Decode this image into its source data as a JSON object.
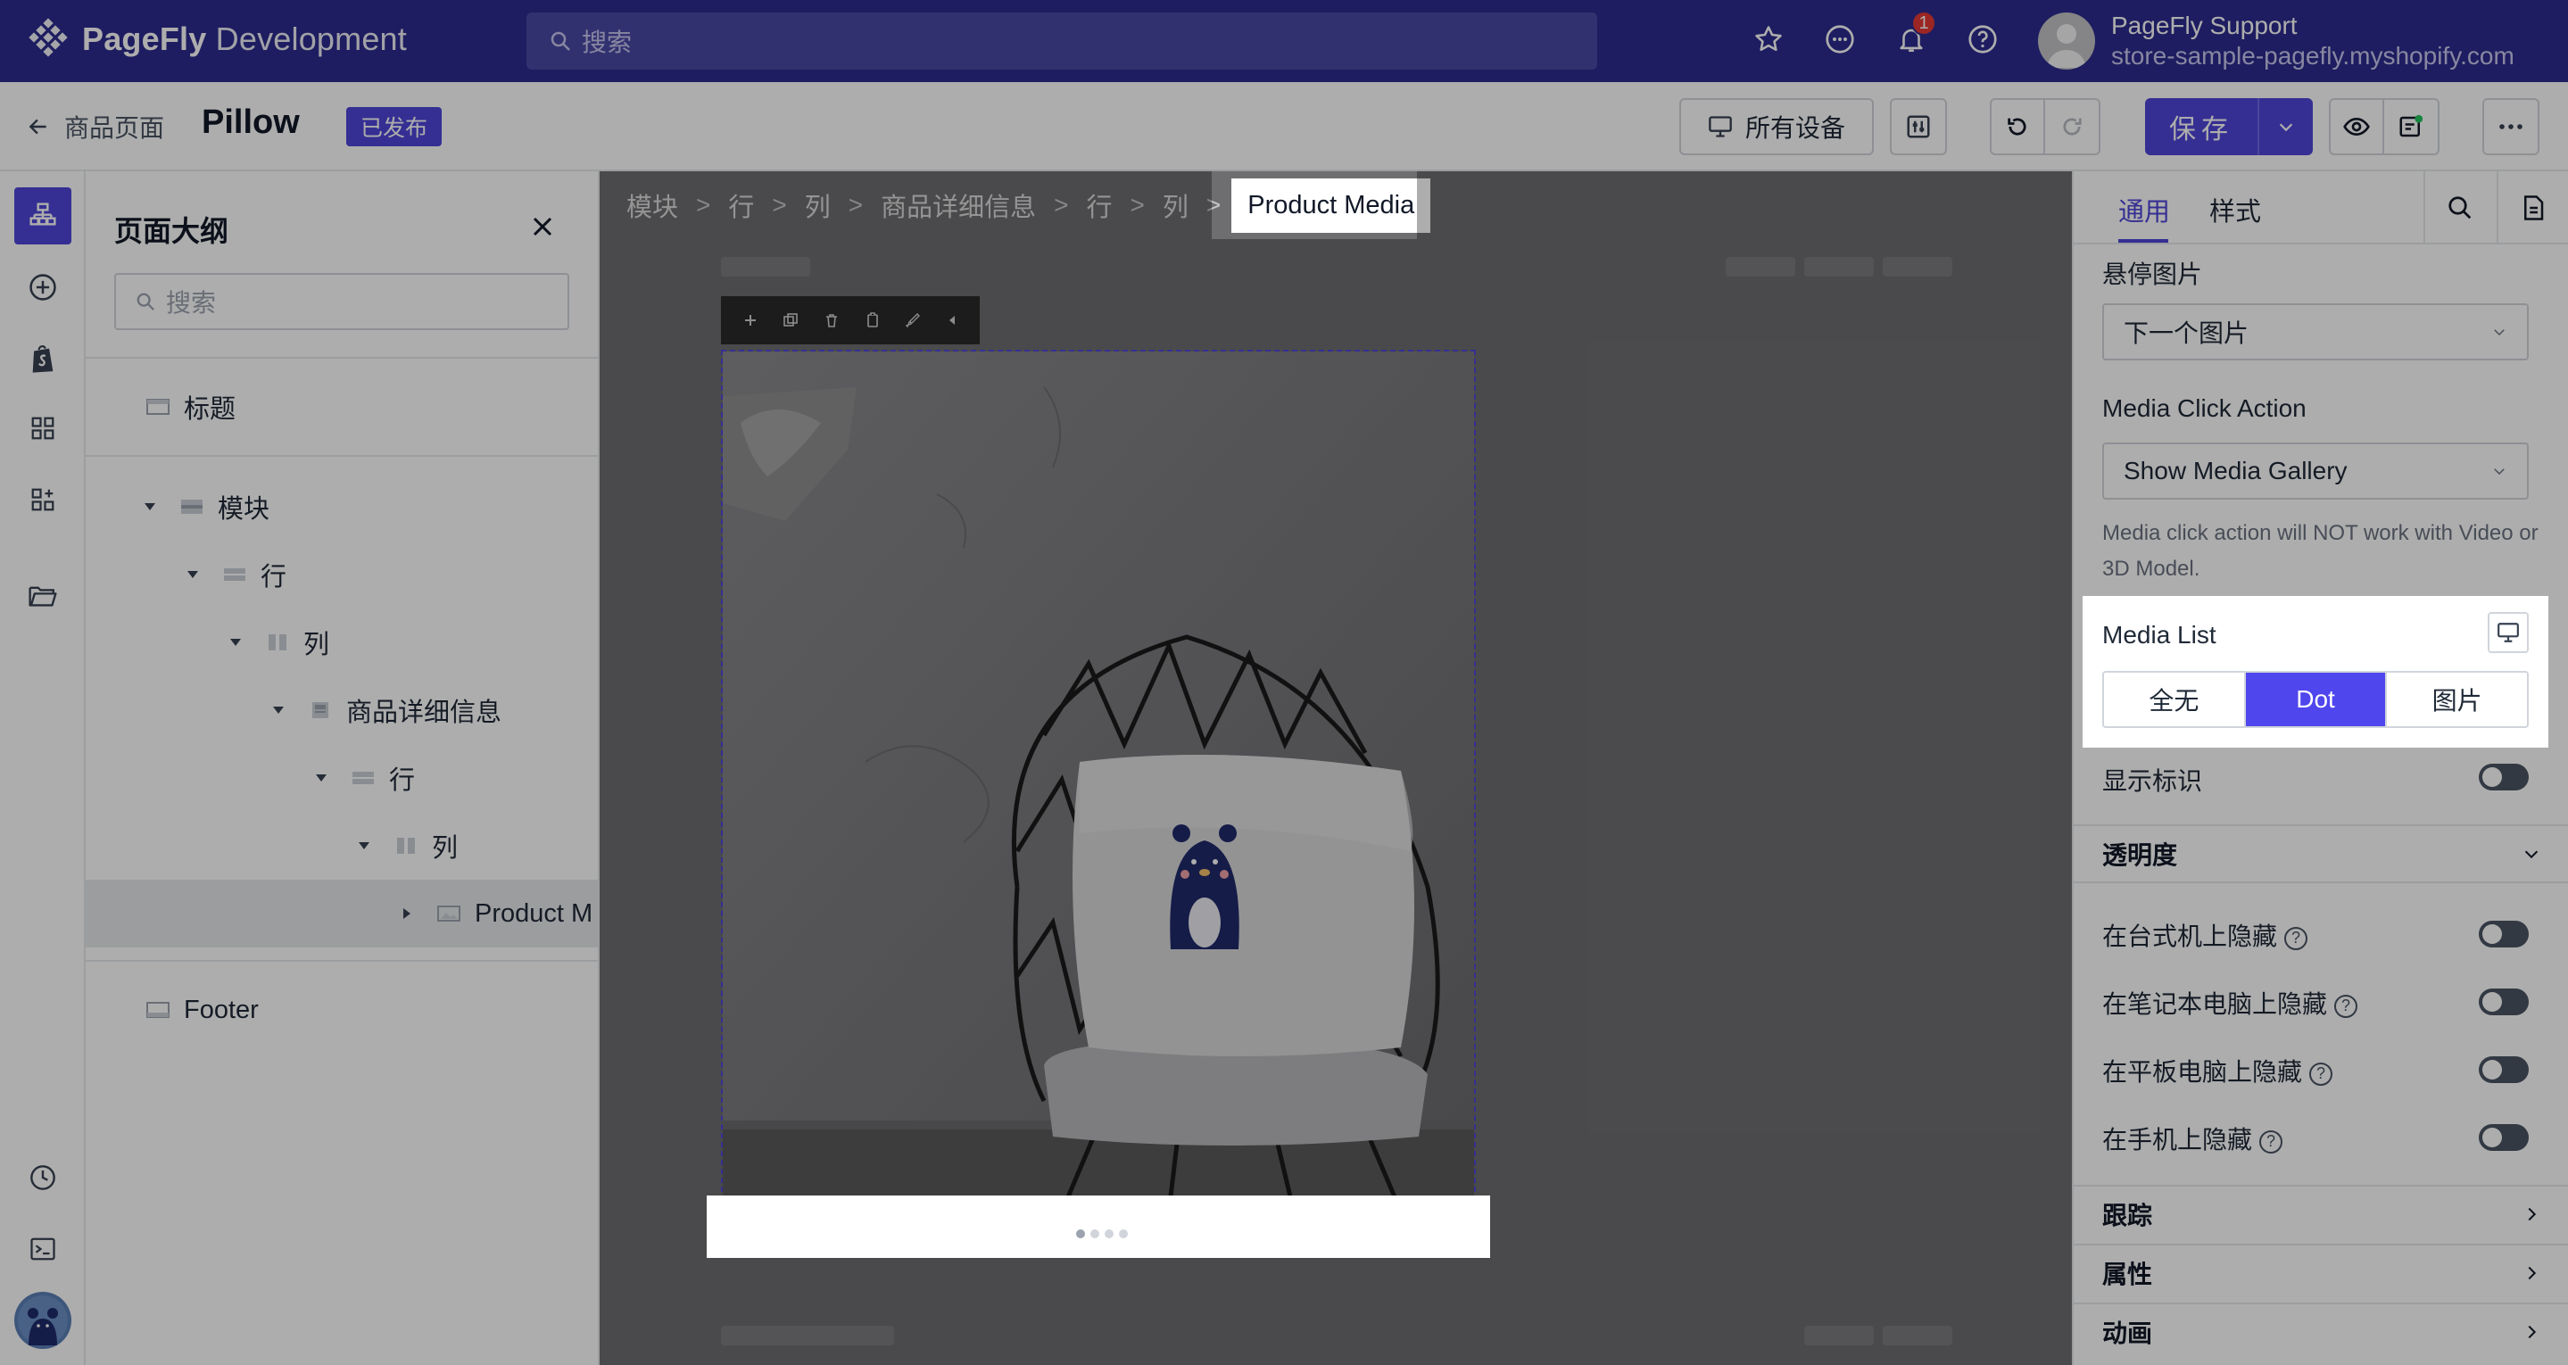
{
  "app": {
    "logo_bold": "PageFly",
    "logo_rest": " Development",
    "search_placeholder": "搜索",
    "notifications_count": "1",
    "user_name": "PageFly Support",
    "user_store": "store-sample-pagefly.myshopify.com"
  },
  "toolbar": {
    "back_label": "商品页面",
    "page_title": "Pillow",
    "status_badge": "已发布",
    "devices_label": "所有设备",
    "save_label": "保存"
  },
  "outline": {
    "title": "页面大纲",
    "search_placeholder": "搜索",
    "items": [
      {
        "label": "标题"
      },
      {
        "label": "模块"
      },
      {
        "label": "行"
      },
      {
        "label": "列"
      },
      {
        "label": "商品详细信息"
      },
      {
        "label": "行"
      },
      {
        "label": "列"
      },
      {
        "label": "Product M"
      },
      {
        "label": "Footer"
      }
    ]
  },
  "breadcrumbs": [
    "模块",
    "行",
    "列",
    "商品详细信息",
    "行",
    "列",
    "Product Media"
  ],
  "right_panel": {
    "tabs": [
      "通用",
      "样式"
    ],
    "hover_image_label": "悬停图片",
    "hover_image_value": "下一个图片",
    "media_click_label": "Media Click Action",
    "media_click_value": "Show Media Gallery",
    "media_click_help": "Media click action will NOT work with Video or 3D Model.",
    "media_list_label": "Media List",
    "media_list_options": [
      "全无",
      "Dot",
      "图片"
    ],
    "media_list_selected": "Dot",
    "show_badge_label": "显示标识",
    "opacity_section": "透明度",
    "hide_desktop": "在台式机上隐藏",
    "hide_laptop": "在笔记本电脑上隐藏",
    "hide_tablet": "在平板电脑上隐藏",
    "hide_mobile": "在手机上隐藏",
    "tracking_section": "跟踪",
    "attributes_section": "属性",
    "animation_section": "动画"
  },
  "colors": {
    "brand": "#2d2c8f",
    "accent": "#4f46d9"
  }
}
